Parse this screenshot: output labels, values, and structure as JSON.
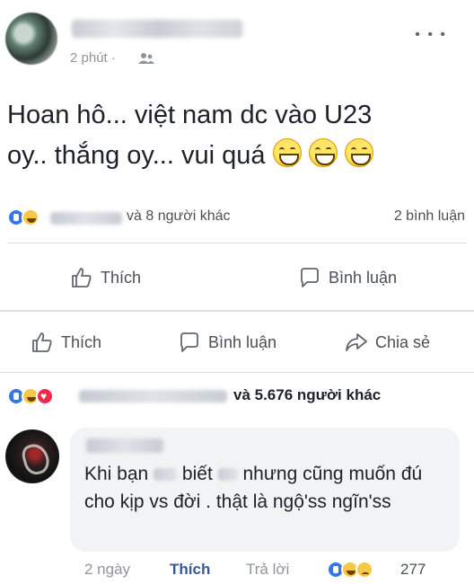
{
  "post": {
    "time": "2 phút ·",
    "text_line1": "Hoan hô... việt nam dc vào U23",
    "text_line2": "oy.. thắng oy... vui quá",
    "emojis": [
      "grinning-emoji",
      "grinning-emoji",
      "grinning-emoji"
    ],
    "reaction_others": "và 8 người khác",
    "comment_count": "2 bình luận",
    "actions": {
      "like": "Thích",
      "comment": "Bình luận"
    }
  },
  "share_actions": {
    "like": "Thích",
    "comment": "Bình luận",
    "share": "Chia sẻ"
  },
  "shared_reactions": {
    "others": "và 5.676 người khác"
  },
  "comment": {
    "text_part1": "Khi bạn",
    "text_part2": "biết",
    "text_part3": "nhưng cũng muốn đú cho kịp vs đời . thật là ngộ'ss ngĩn'ss",
    "time": "2 ngày",
    "like": "Thích",
    "reply": "Trả lời",
    "reaction_count": "277"
  },
  "colors": {
    "like_blue": "#3578e5",
    "link_blue": "#385898",
    "love_red": "#f0284a",
    "haha_yellow": "#f7c844",
    "divider": "#dadde1"
  }
}
